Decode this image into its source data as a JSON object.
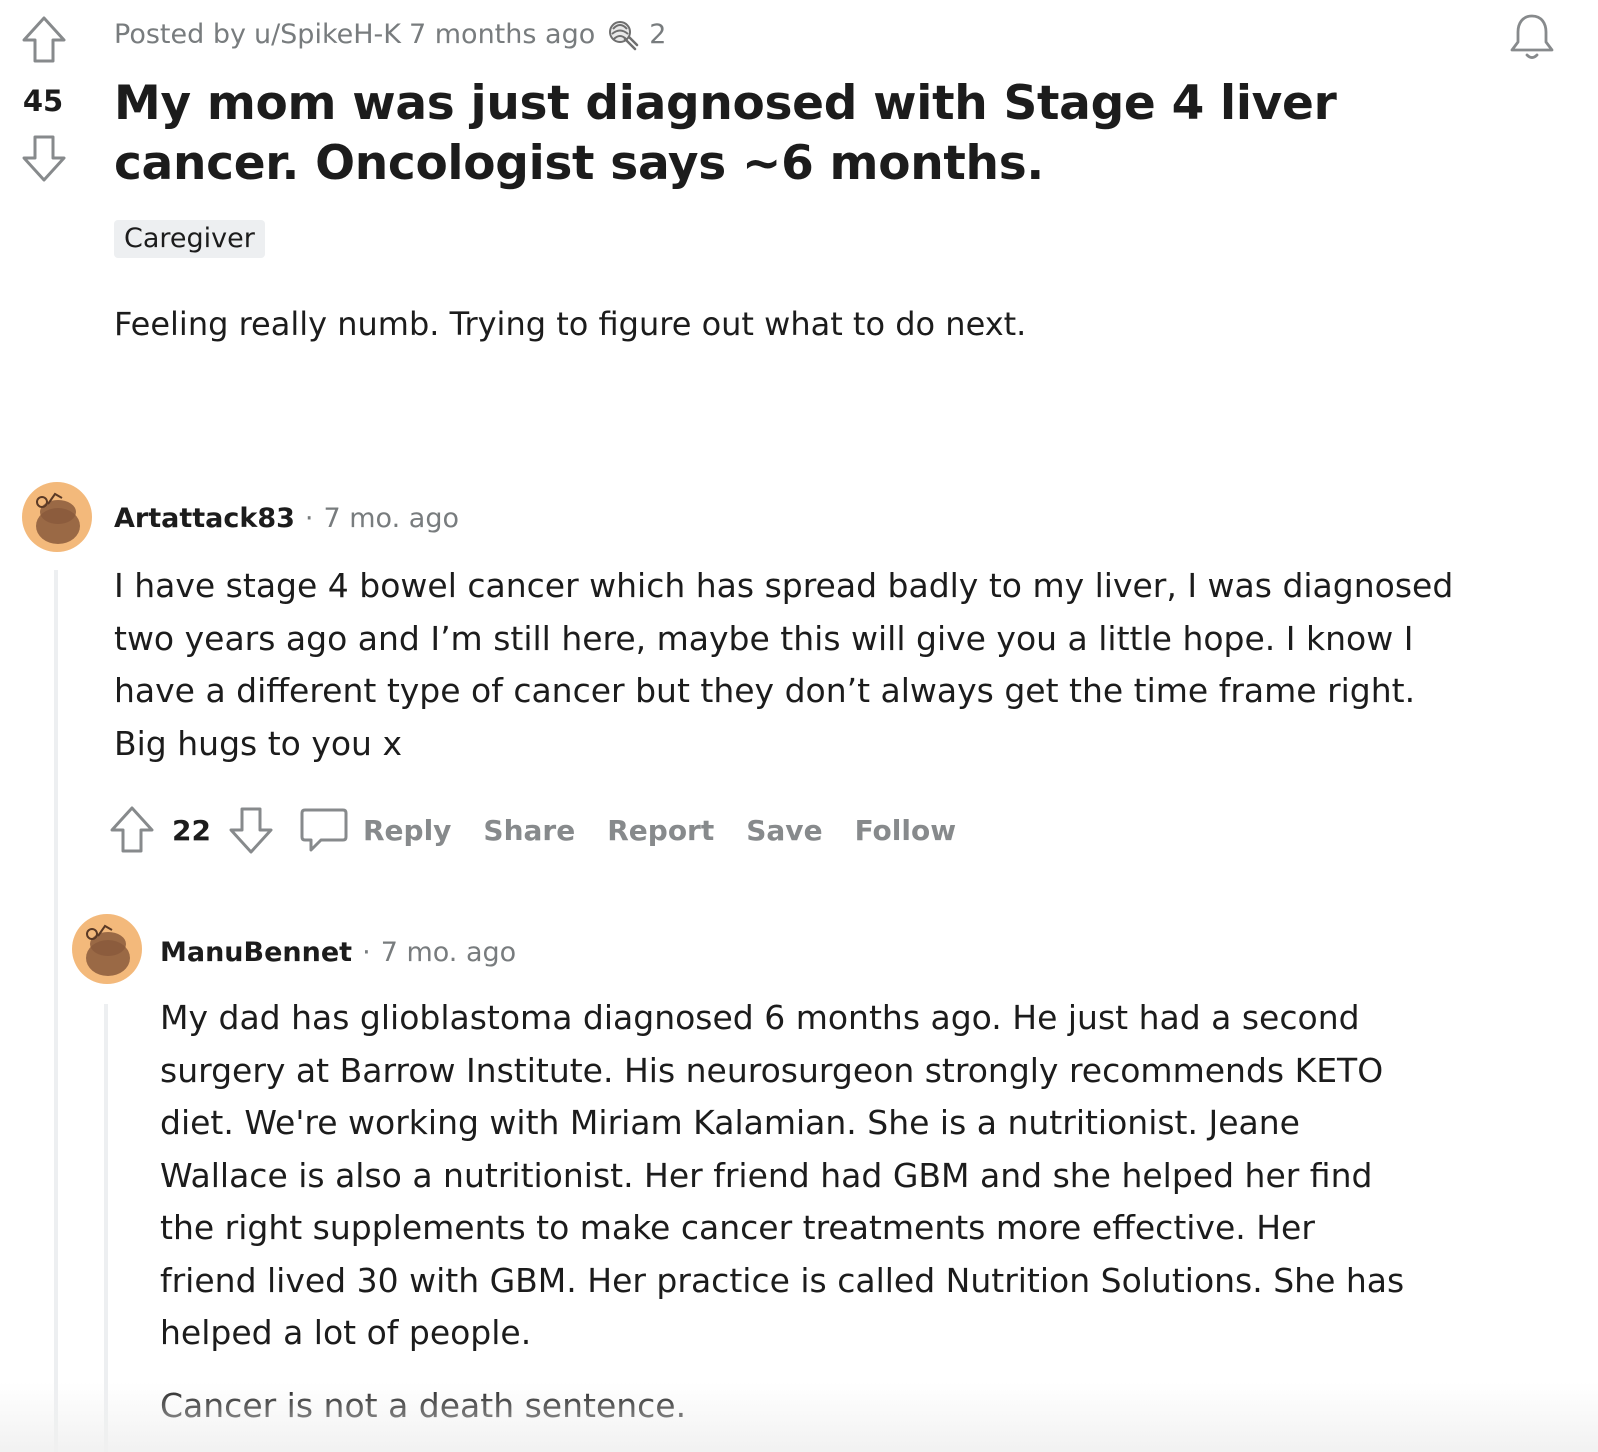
{
  "post": {
    "score": "45",
    "meta_prefix": "Posted by",
    "author": "u/SpikeH-K",
    "time": "7 months ago",
    "award_count": "2",
    "title": "My mom was just diagnosed with Stage 4 liver cancer. Oncologist says ~6 months.",
    "flair": "Caregiver",
    "body": "Feeling really numb. Trying to figure out what to do next."
  },
  "comments": [
    {
      "author": "Artattack83",
      "separator": "·",
      "time": "7 mo. ago",
      "text": "I have stage 4 bowel cancer which has spread badly to my liver, I was diagnosed two years ago and I’m still here, maybe this will give you a little hope. I know I have a different type of cancer but they don’t always get the time frame right. Big hugs to you x",
      "score": "22",
      "actions": {
        "reply": "Reply",
        "share": "Share",
        "report": "Report",
        "save": "Save",
        "follow": "Follow"
      }
    },
    {
      "author": "ManuBennet",
      "separator": "·",
      "time": "7 mo. ago",
      "paragraphs": [
        "My dad has glioblastoma diagnosed 6 months ago. He just had a second surgery at Barrow Institute. His neurosurgeon strongly recommends KETO diet. We're working with Miriam Kalamian. She is a nutritionist. Jeane Wallace is also a nutritionist. Her friend had GBM and she helped her find the right supplements to make cancer treatments more effective. Her friend lived 30 with GBM. Her practice is called Nutrition Solutions. She has helped a lot of people.",
        "Cancer is not a death sentence."
      ]
    }
  ],
  "icons": {
    "upvote": "upvote-arrow-icon",
    "downvote": "downvote-arrow-icon",
    "bell": "bell-icon",
    "award": "award-icon",
    "comment": "comment-bubble-icon",
    "avatar": "snoo-avatar-icon"
  },
  "colors": {
    "text": "#1c1c1c",
    "meta": "#787c7e",
    "action": "#878a8c",
    "avatar_bg": "#f3b97b",
    "flair_bg": "#edeff1",
    "thread_line": "#edeff1"
  }
}
